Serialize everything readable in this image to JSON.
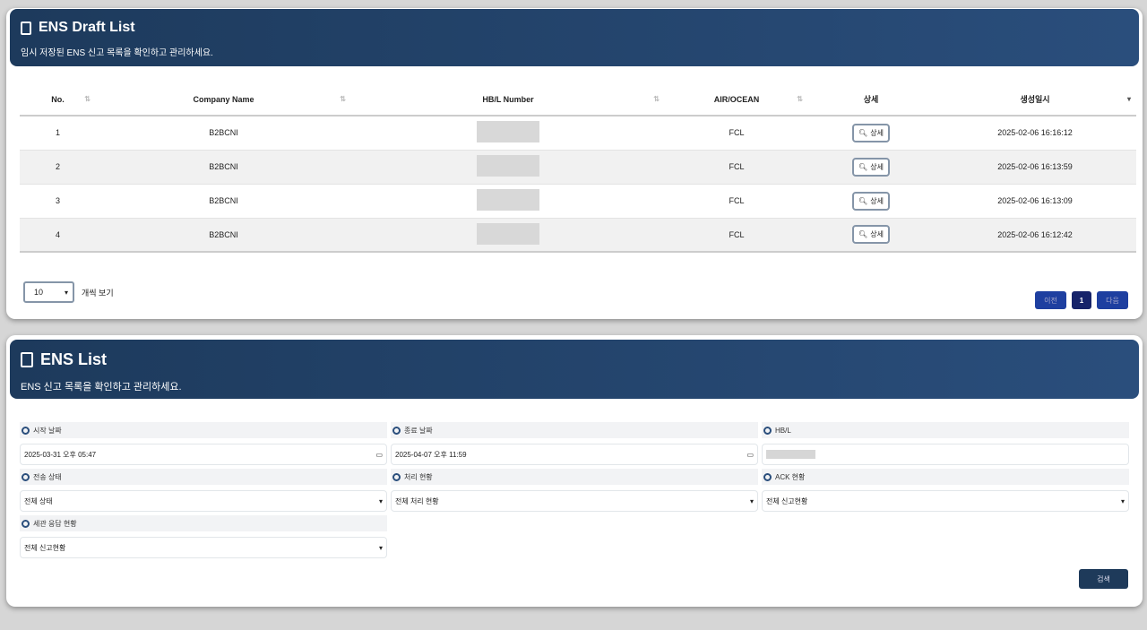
{
  "draft": {
    "title": "ENS Draft List",
    "subtitle": "임시 저장된 ENS 신고 목록을 확인하고 관리하세요.",
    "columns": [
      "No.",
      "Company Name",
      "HB/L Number",
      "AIR/OCEAN",
      "상세",
      "생성일시"
    ],
    "rows": [
      {
        "no": "1",
        "company": "B2BCNI",
        "mode": "FCL",
        "detail": "상세",
        "created": "2025-02-06 16:16:12"
      },
      {
        "no": "2",
        "company": "B2BCNI",
        "mode": "FCL",
        "detail": "상세",
        "created": "2025-02-06 16:13:59"
      },
      {
        "no": "3",
        "company": "B2BCNI",
        "mode": "FCL",
        "detail": "상세",
        "created": "2025-02-06 16:13:09"
      },
      {
        "no": "4",
        "company": "B2BCNI",
        "mode": "FCL",
        "detail": "상세",
        "created": "2025-02-06 16:12:42"
      }
    ],
    "page_size": "10",
    "page_size_label": "개씩 보기",
    "prev": "이전",
    "page": "1",
    "next": "다음"
  },
  "ens": {
    "title": "ENS List",
    "subtitle": "ENS 신고 목록을 확인하고 관리하세요.",
    "start_label": "시작 날짜",
    "start_value": "2025-03-31 오후 05:47",
    "end_label": "종료 날짜",
    "end_value": "2025-04-07 오후 11:59",
    "hbl_label": "HB/L",
    "send_label": "전송 상태",
    "send_value": "전체 상태",
    "proc_label": "처리 현황",
    "proc_value": "전체 처리 현황",
    "ack_label": "ACK 현황",
    "ack_value": "전체 신고현황",
    "customs_label": "세관 응답 현황",
    "customs_value": "전체 신고현황",
    "search": "검색"
  }
}
